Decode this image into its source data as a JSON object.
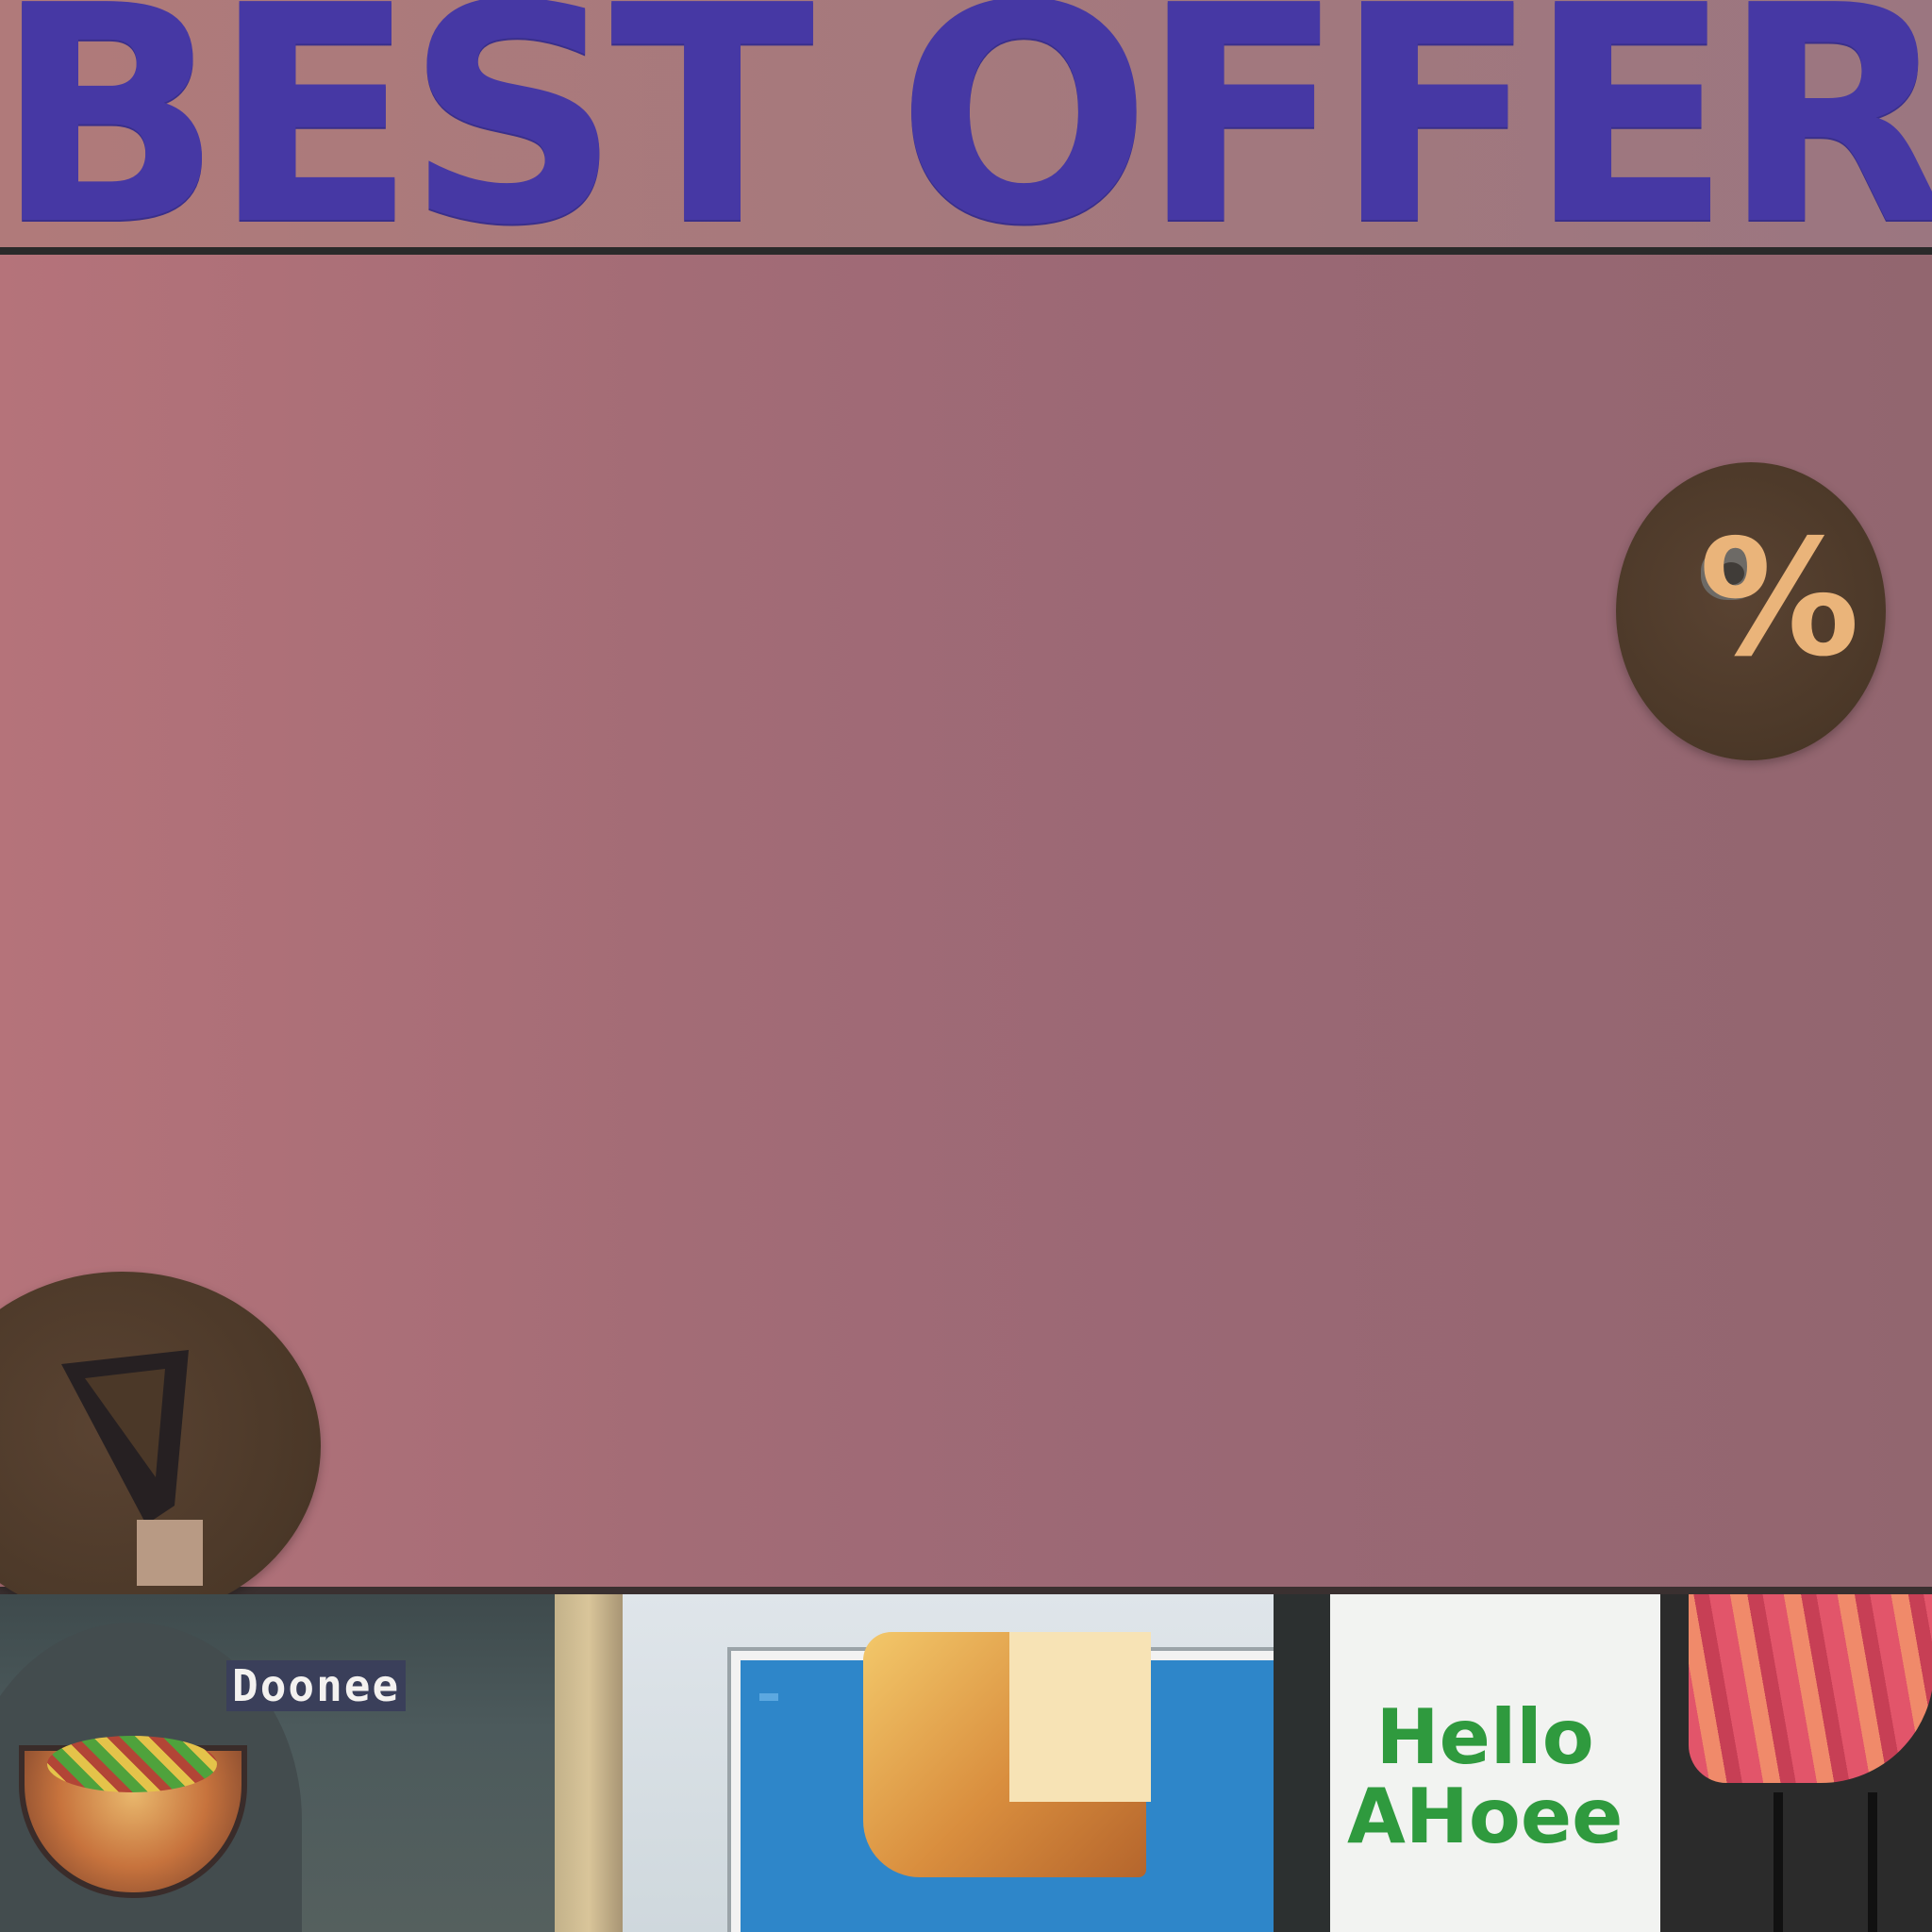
{
  "header": {
    "title": "BEST OFFER"
  },
  "badges": {
    "discount": {
      "glyph": "%",
      "icon": "percent-icon",
      "color": "#eab47a"
    },
    "checkmark": {
      "icon": "check-icon"
    }
  },
  "colors": {
    "title": "#4638a4",
    "panel": "#a36c76",
    "badge": "#4b3828"
  },
  "collage": {
    "tile_1_top": "",
    "tile_1_lines": [
      "Doonee",
      "",
      "",
      ""
    ],
    "tile_3_sign": "",
    "tile_4_sign": "Hello\nAHoee"
  }
}
